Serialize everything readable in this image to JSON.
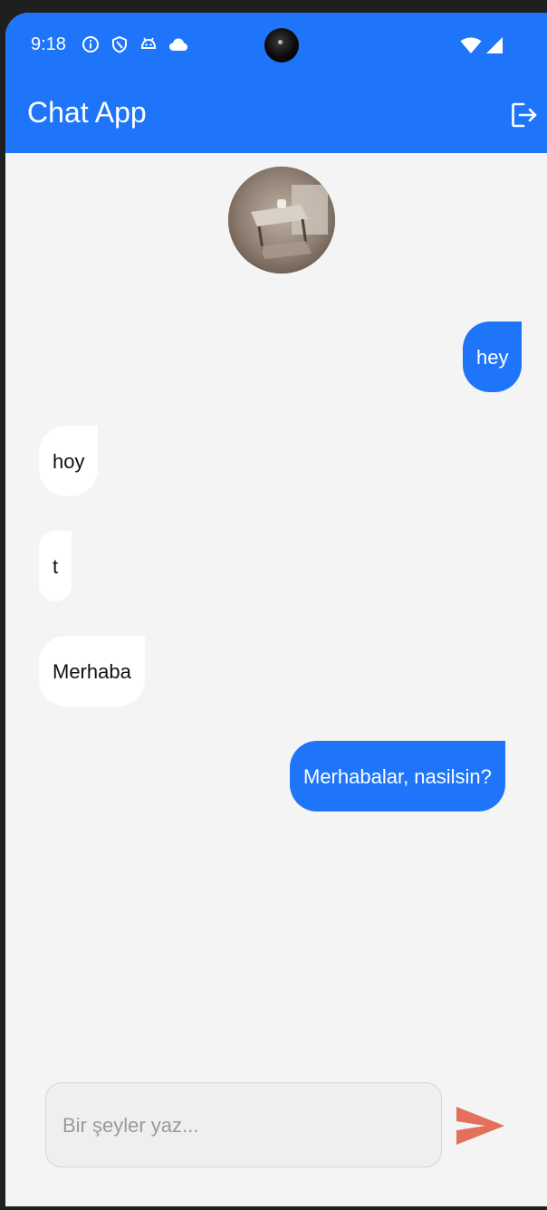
{
  "status_bar": {
    "time": "9:18",
    "icons": [
      "info-icon",
      "shield-icon",
      "android-icon",
      "cloud-icon",
      "wifi-icon",
      "signal-icon"
    ]
  },
  "app_bar": {
    "title": "Chat App",
    "action_icon": "logout-icon"
  },
  "chat": {
    "avatar": "profile-photo",
    "messages": [
      {
        "text": "hey",
        "direction": "sent"
      },
      {
        "text": "hoy",
        "direction": "received"
      },
      {
        "text": "t",
        "direction": "received"
      },
      {
        "text": "Merhaba",
        "direction": "received"
      },
      {
        "text": "Merhabalar, nasilsin?",
        "direction": "sent"
      }
    ]
  },
  "composer": {
    "placeholder": "Bir şeyler yaz...",
    "value": "",
    "send_icon": "send-icon"
  },
  "colors": {
    "primary": "#1e75fa",
    "background": "#f4f4f4",
    "received_bubble": "#ffffff",
    "send_button": "#e2705a"
  }
}
